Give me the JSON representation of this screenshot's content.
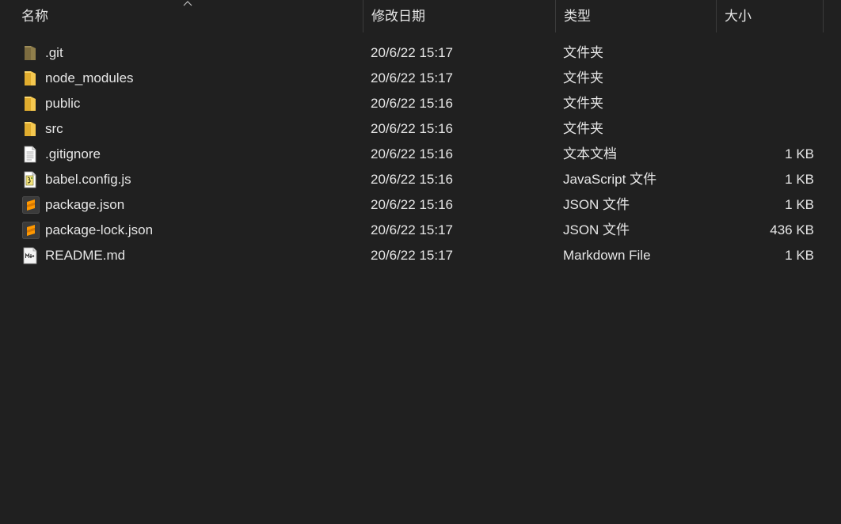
{
  "header": {
    "name_label": "名称",
    "date_label": "修改日期",
    "type_label": "类型",
    "size_label": "大小",
    "sort_icon": "chevron-up-icon"
  },
  "colors": {
    "background": "#202020",
    "text": "#e6e6e6",
    "folder": "#f2c44e",
    "git_folder": "#8f7e4b",
    "sublime": "#ff9800"
  },
  "files": [
    {
      "name": ".git",
      "date": "20/6/22 15:17",
      "type": "文件夹",
      "size": "",
      "icon": "git-folder-icon"
    },
    {
      "name": "node_modules",
      "date": "20/6/22 15:17",
      "type": "文件夹",
      "size": "",
      "icon": "folder-icon"
    },
    {
      "name": "public",
      "date": "20/6/22 15:16",
      "type": "文件夹",
      "size": "",
      "icon": "folder-icon"
    },
    {
      "name": "src",
      "date": "20/6/22 15:16",
      "type": "文件夹",
      "size": "",
      "icon": "folder-icon"
    },
    {
      "name": ".gitignore",
      "date": "20/6/22 15:16",
      "type": "文本文档",
      "size": "1 KB",
      "icon": "text-file-icon"
    },
    {
      "name": "babel.config.js",
      "date": "20/6/22 15:16",
      "type": "JavaScript 文件",
      "size": "1 KB",
      "icon": "js-file-icon"
    },
    {
      "name": "package.json",
      "date": "20/6/22 15:16",
      "type": "JSON 文件",
      "size": "1 KB",
      "icon": "sublime-file-icon"
    },
    {
      "name": "package-lock.json",
      "date": "20/6/22 15:17",
      "type": "JSON 文件",
      "size": "436 KB",
      "icon": "sublime-file-icon"
    },
    {
      "name": "README.md",
      "date": "20/6/22 15:17",
      "type": "Markdown File",
      "size": "1 KB",
      "icon": "markdown-file-icon"
    }
  ]
}
